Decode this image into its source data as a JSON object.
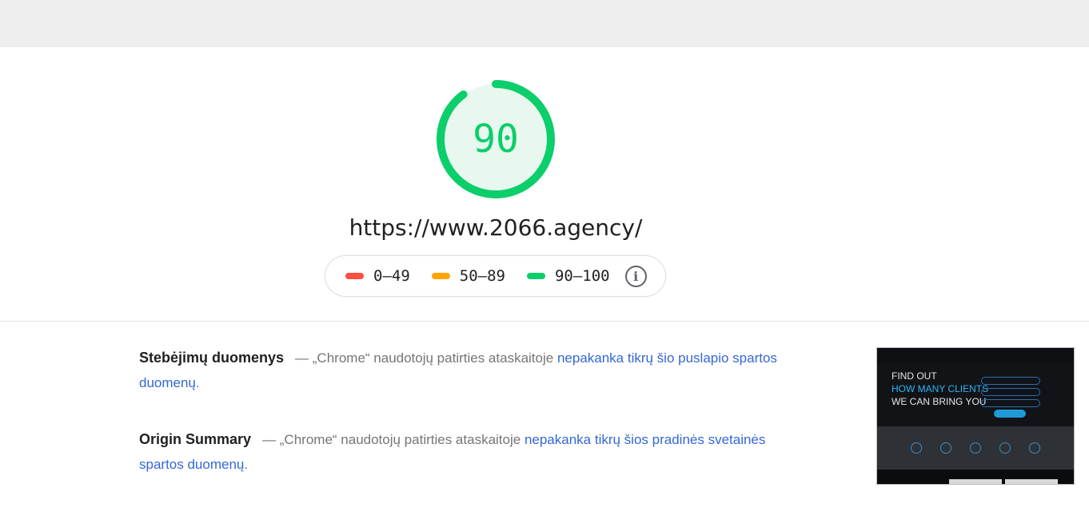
{
  "score": {
    "value": "90",
    "fraction": 0.9,
    "color": "#0cce6b",
    "bg_color": "#e8f8ef"
  },
  "url": "https://www.2066.agency/",
  "legend": {
    "items": [
      {
        "label": "0–49",
        "color": "#ff4e42"
      },
      {
        "label": "50–89",
        "color": "#ffa400"
      },
      {
        "label": "90–100",
        "color": "#0cce6b"
      }
    ],
    "info_icon": "info-icon"
  },
  "sections": [
    {
      "title": "Stebėjimų duomenys",
      "text": "— „Chrome“ naudotojų patirties ataskaitoje ",
      "link": "nepakanka tikrų šio puslapio spartos duomenų",
      "end": "."
    },
    {
      "title": "Origin Summary",
      "text": "— „Chrome“ naudotojų patirties ataskaitoje ",
      "link": "nepakanka tikrų šios pradinės svetainės spartos duomenų",
      "end": "."
    }
  ],
  "thumbnail": {
    "line1": "FIND OUT",
    "line2": "HOW MANY CLIENTS",
    "line3": "WE CAN BRING YOU"
  },
  "colors": {
    "link": "#3367d6",
    "topbar": "#eeeeee"
  }
}
